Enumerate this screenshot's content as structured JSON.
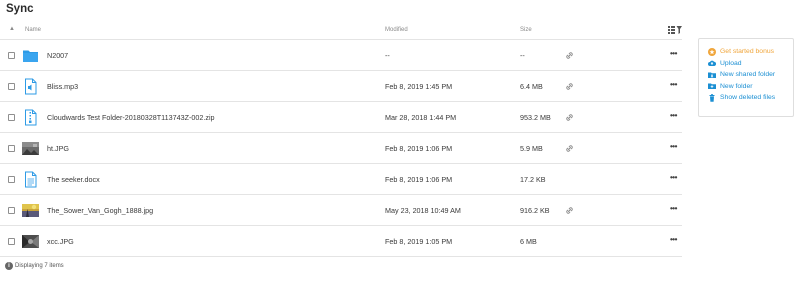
{
  "page": {
    "title": "Sync"
  },
  "header": {
    "name": "Name",
    "modified": "Modified",
    "size": "Size"
  },
  "files": [
    {
      "name": "N2007",
      "modified": "--",
      "size": "--",
      "icon": "folder-icon",
      "has_link": true
    },
    {
      "name": "Bliss.mp3",
      "modified": "Feb 8, 2019 1:45 PM",
      "size": "6.4 MB",
      "icon": "audio-file-icon",
      "has_link": true
    },
    {
      "name": "Cloudwards Test Folder-20180328T113743Z-002.zip",
      "modified": "Mar 28, 2018 1:44 PM",
      "size": "953.2 MB",
      "icon": "zip-file-icon",
      "has_link": true
    },
    {
      "name": "ht.JPG",
      "modified": "Feb 8, 2019 1:06 PM",
      "size": "5.9 MB",
      "icon": "image-thumbnail-icon",
      "has_link": true
    },
    {
      "name": "The seeker.docx",
      "modified": "Feb 8, 2019 1:06 PM",
      "size": "17.2 KB",
      "icon": "document-file-icon",
      "has_link": false
    },
    {
      "name": "The_Sower_Van_Gogh_1888.jpg",
      "modified": "May 23, 2018 10:49 AM",
      "size": "916.2 KB",
      "icon": "painting-thumbnail-icon",
      "has_link": true
    },
    {
      "name": "xcc.JPG",
      "modified": "Feb 8, 2019 1:05 PM",
      "size": "6 MB",
      "icon": "photo-thumbnail-icon",
      "has_link": false
    }
  ],
  "footer": {
    "status": "Displaying 7 items"
  },
  "side_panel": {
    "items": [
      {
        "label": "Get started bonus",
        "icon": "star-icon"
      },
      {
        "label": "Upload",
        "icon": "cloud-upload-icon"
      },
      {
        "label": "New shared folder",
        "icon": "shared-folder-icon"
      },
      {
        "label": "New folder",
        "icon": "new-folder-icon"
      },
      {
        "label": "Show deleted files",
        "icon": "trash-icon"
      }
    ]
  },
  "colors": {
    "accent": "#1b8fd3",
    "bonus": "#f0a53a",
    "folder": "#2e9be6",
    "border": "#e4e4e4"
  }
}
